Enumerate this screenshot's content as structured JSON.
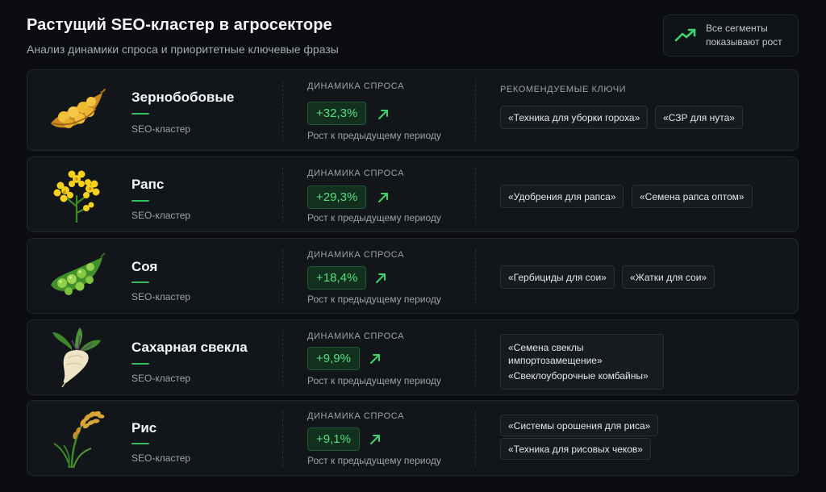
{
  "header": {
    "title": "Растущий SEO-кластер в агросекторе",
    "subtitle": "Анализ динамики спроса и приоритетные ключевые фразы"
  },
  "badge": {
    "icon": "trend-up-icon",
    "text": "Все сегменты показывают рост"
  },
  "labels": {
    "dynamics": "ДИНАМИКА СПРОСА",
    "growth": "Рост к предыдущему периоду",
    "keywords": "РЕКОМЕНДУЕМЫЕ КЛЮЧИ",
    "cluster": "SEO-кластер"
  },
  "colors": {
    "accent": "#2fbf5f",
    "positive": "#54e07f",
    "card": "#121519",
    "background": "#0b0d10"
  },
  "clusters": [
    {
      "name": "Зернобобовые",
      "icon": "peas-pod-icon",
      "change": "+32,3%",
      "keywords": [
        "«Техника для уборки гороха»",
        "«СЗР для нута»"
      ]
    },
    {
      "name": "Рапс",
      "icon": "rapeseed-flower-icon",
      "change": "+29,3%",
      "keywords": [
        "«Удобрения для рапса»",
        "«Семена рапса оптом»"
      ]
    },
    {
      "name": "Соя",
      "icon": "soybean-pod-icon",
      "change": "+18,4%",
      "keywords": [
        "«Гербициды для сои»",
        "«Жатки для сои»"
      ]
    },
    {
      "name": "Сахарная свекла",
      "icon": "sugar-beet-icon",
      "change": "+9,9%",
      "keywords": [
        "«Семена свеклы импортозамещение»",
        "«Свеклоуборочные комбайны»"
      ]
    },
    {
      "name": "Рис",
      "icon": "rice-stalk-icon",
      "change": "+9,1%",
      "keywords": [
        "«Системы орошения для риса»",
        "«Техника для рисовых чеков»"
      ]
    }
  ]
}
